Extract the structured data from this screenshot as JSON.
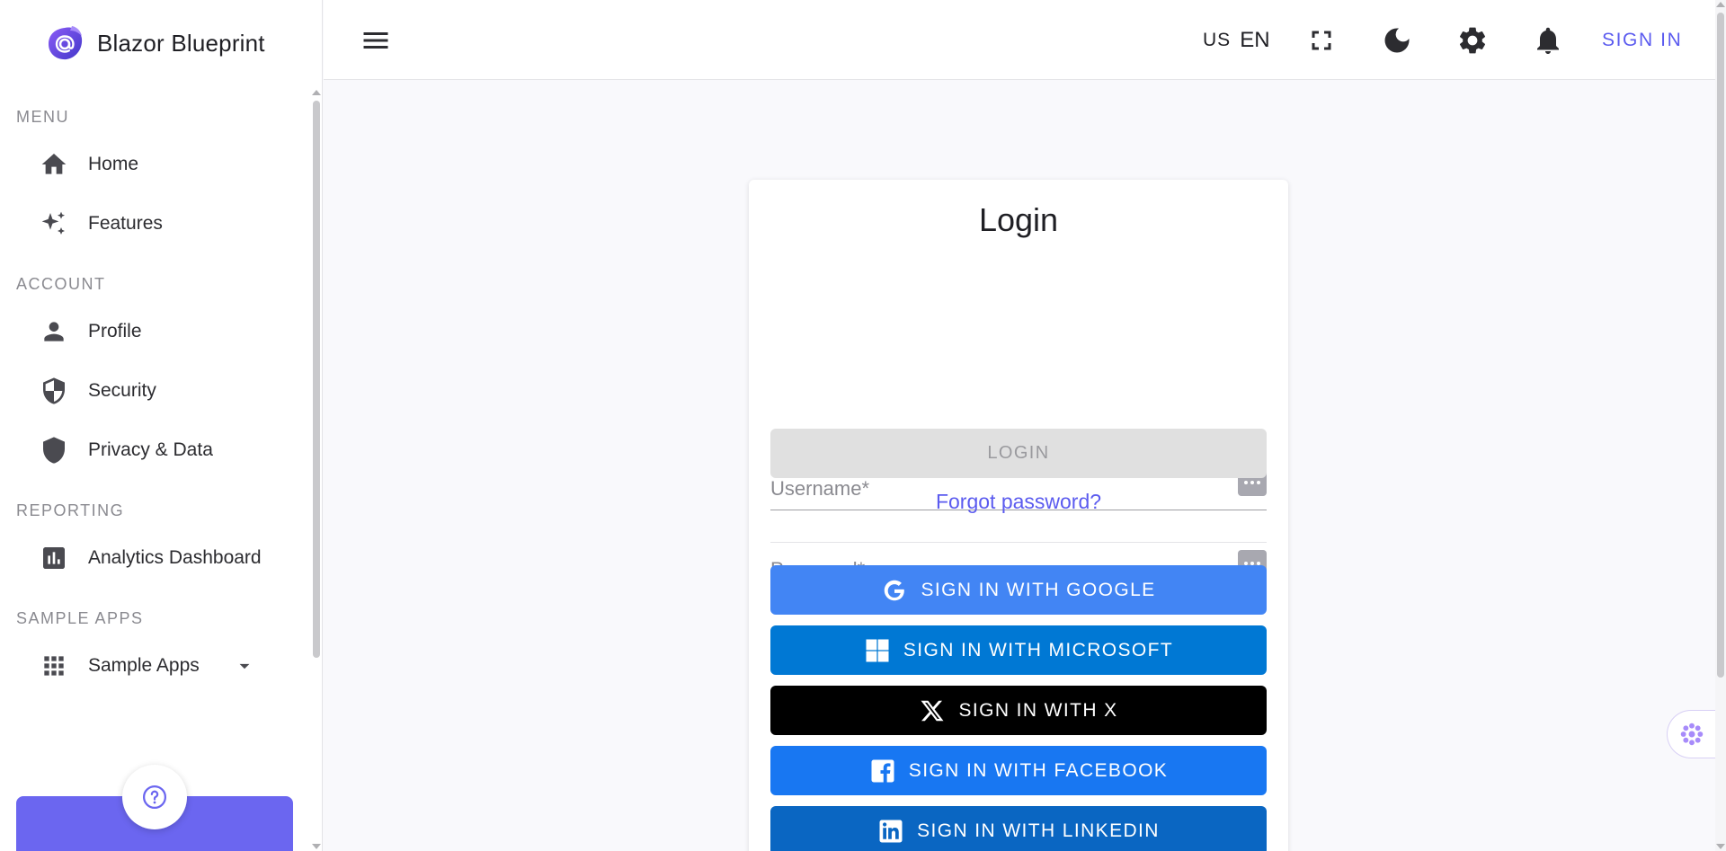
{
  "brand": {
    "name": "Blazor Blueprint",
    "logo_icon": "at-sign-logo-icon"
  },
  "sidebar": {
    "sections": [
      {
        "heading": "MENU",
        "items": [
          {
            "label": "Home",
            "icon": "home-icon"
          },
          {
            "label": "Features",
            "icon": "sparkles-icon"
          }
        ]
      },
      {
        "heading": "ACCOUNT",
        "items": [
          {
            "label": "Profile",
            "icon": "person-icon"
          },
          {
            "label": "Security",
            "icon": "shield-half-icon"
          },
          {
            "label": "Privacy & Data",
            "icon": "shield-icon"
          }
        ]
      },
      {
        "heading": "REPORTING",
        "items": [
          {
            "label": "Analytics Dashboard",
            "icon": "bar-chart-icon"
          }
        ]
      },
      {
        "heading": "SAMPLE APPS",
        "items": [
          {
            "label": "Sample Apps",
            "icon": "grid-icon",
            "expandable": true
          }
        ]
      }
    ],
    "help_icon": "help-circle-icon"
  },
  "topbar": {
    "language_flag": "US",
    "language_code": "EN",
    "icons": [
      "fullscreen-icon",
      "moon-icon",
      "gear-icon",
      "bell-icon"
    ],
    "sign_in_label": "SIGN IN"
  },
  "login": {
    "title": "Login",
    "username_placeholder": "Username*",
    "password_placeholder": "Password*",
    "login_button": "LOGIN",
    "forgot_password": "Forgot password?",
    "providers": [
      {
        "label": "SIGN IN WITH GOOGLE",
        "color": "#4285f4",
        "icon": "google-icon"
      },
      {
        "label": "SIGN IN WITH MICROSOFT",
        "color": "#0078d4",
        "icon": "microsoft-icon"
      },
      {
        "label": "SIGN IN WITH X",
        "color": "#000000",
        "icon": "x-icon"
      },
      {
        "label": "SIGN IN WITH FACEBOOK",
        "color": "#1877f2",
        "icon": "facebook-icon"
      },
      {
        "label": "SIGN IN WITH LINKEDIN",
        "color": "#0a66c2",
        "icon": "linkedin-icon"
      }
    ]
  },
  "colors": {
    "accent": "#5b5bef",
    "promo": "#6b66f0"
  }
}
